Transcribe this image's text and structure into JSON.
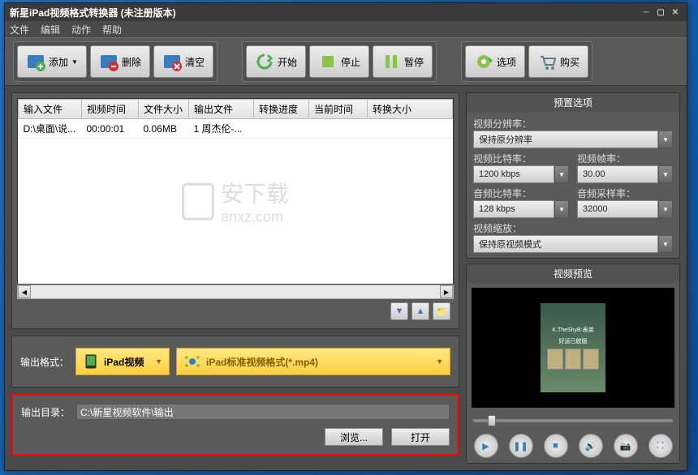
{
  "title": "新星iPad视频格式转换器   (未注册版本)",
  "menu": {
    "file": "文件",
    "edit": "编辑",
    "action": "动作",
    "help": "帮助"
  },
  "toolbar": {
    "add": "添加",
    "delete": "删除",
    "clear": "清空",
    "start": "开始",
    "stop": "停止",
    "pause": "暂停",
    "options": "选项",
    "buy": "购买"
  },
  "table": {
    "headers": {
      "input": "输入文件",
      "vtime": "视频时间",
      "fsize": "文件大小",
      "output": "输出文件",
      "progress": "转换进度",
      "curtime": "当前时间",
      "csize": "转换大小"
    },
    "rows": [
      {
        "input": "D:\\桌面\\说...",
        "vtime": "00:00:01",
        "fsize": "0.06MB",
        "output": "1 周杰伦-...",
        "progress": "",
        "curtime": "",
        "csize": ""
      }
    ]
  },
  "watermark": {
    "text1": "安下载",
    "text2": "anxz.com"
  },
  "format": {
    "label": "输出格式：",
    "category": "iPad视频",
    "selected": "iPad标准视频格式(*.mp4)"
  },
  "output": {
    "label": "输出目录：",
    "path": "C:\\新星视频软件\\输出",
    "browse": "浏览...",
    "open": "打开"
  },
  "preset": {
    "title": "预置选项",
    "vres_label": "视频分辨率：",
    "vres": "保持原分辨率",
    "vbit_label": "视频比特率：",
    "vbit": "1200 kbps",
    "vfps_label": "视频帧率：",
    "vfps": "30.00",
    "abit_label": "音频比特率：",
    "abit": "128 kbps",
    "asr_label": "音频采样率：",
    "asr": "32000",
    "vscale_label": "视频缩放：",
    "vscale": "保持原视频模式"
  },
  "preview": {
    "title": "视频预览",
    "caption1": "K.TheShyB:表弟",
    "caption2": "好运已脱版"
  }
}
